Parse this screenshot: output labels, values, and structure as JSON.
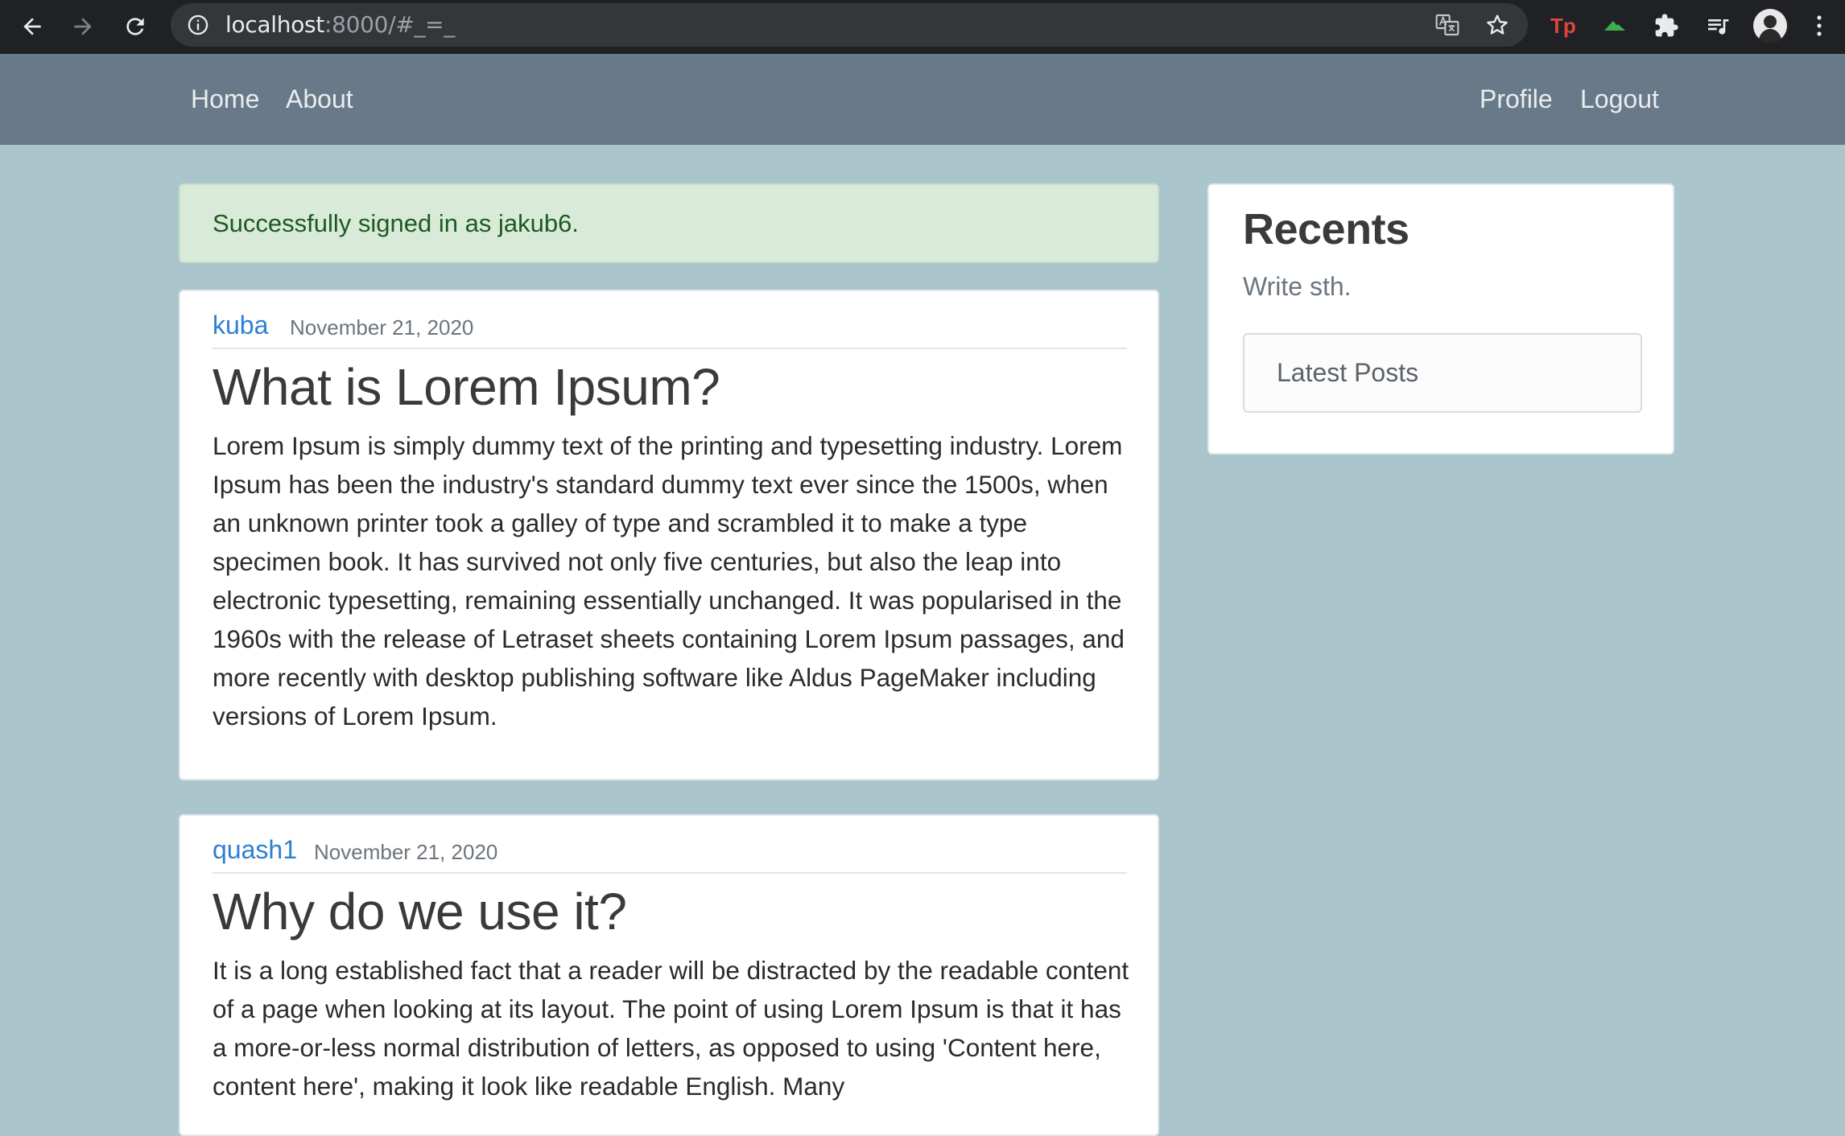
{
  "browser": {
    "url_host": "localhost",
    "url_rest": ":8000/#_=_"
  },
  "navbar": {
    "left": [
      {
        "label": "Home"
      },
      {
        "label": "About"
      }
    ],
    "right": [
      {
        "label": "Profile"
      },
      {
        "label": "Logout"
      }
    ]
  },
  "alert": {
    "message": "Successfully signed in as jakub6."
  },
  "posts": [
    {
      "author": "kuba",
      "date": "November 21, 2020",
      "title": "What is Lorem Ipsum?",
      "body": "Lorem Ipsum is simply dummy text of the printing and typesetting industry. Lorem Ipsum has been the industry's standard dummy text ever since the 1500s, when an unknown printer took a galley of type and scrambled it to make a type specimen book. It has survived not only five centuries, but also the leap into electronic typesetting, remaining essentially unchanged. It was popularised in the 1960s with the release of Letraset sheets containing Lorem Ipsum passages, and more recently with desktop publishing software like Aldus PageMaker including versions of Lorem Ipsum."
    },
    {
      "author": "quash1",
      "date": "November 21, 2020",
      "title": "Why do we use it?",
      "body": "It is a long established fact that a reader will be distracted by the readable content of a page when looking at its layout. The point of using Lorem Ipsum is that it has a more-or-less normal distribution of letters, as opposed to using 'Content here, content here', making it look like readable English. Many"
    }
  ],
  "sidebar": {
    "title": "Recents",
    "subtitle": "Write sth.",
    "items": [
      {
        "label": "Latest Posts"
      }
    ]
  },
  "colors": {
    "page_background": "#aac5cb",
    "navbar": "#687a89",
    "link": "#2d7fd3",
    "alert_background": "#d9ead9",
    "alert_text": "#1d5a22"
  }
}
